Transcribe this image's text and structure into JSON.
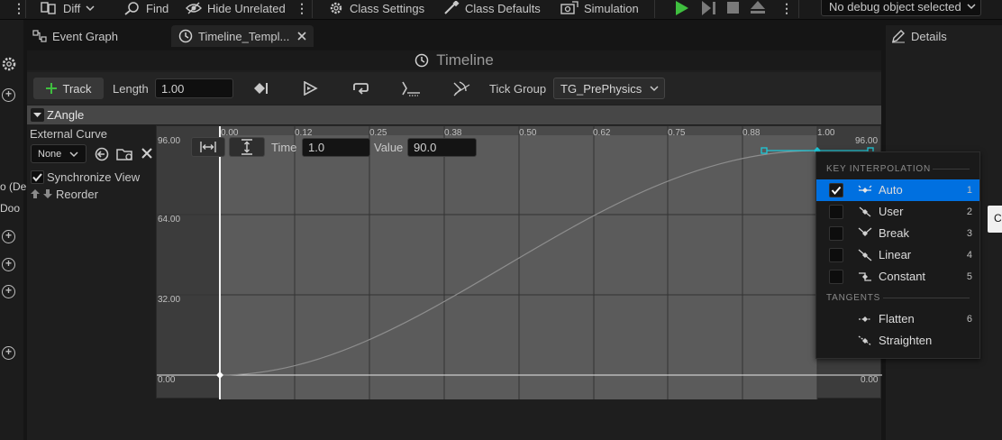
{
  "toolbar": {
    "diff_label": "Diff",
    "find_label": "Find",
    "hide_unrelated_label": "Hide Unrelated",
    "class_settings_label": "Class Settings",
    "class_defaults_label": "Class Defaults",
    "simulation_label": "Simulation",
    "debug_object_value": "No debug object selected"
  },
  "left_strip": {
    "cut_text_1": "o (De",
    "cut_text_2": "Doo"
  },
  "tabs": [
    {
      "label": "Event Graph",
      "icon": "graph-icon"
    },
    {
      "label": "Timeline_Templ...",
      "icon": "clock-icon",
      "active": true
    }
  ],
  "timeline": {
    "title": "Timeline",
    "add_track_label": "Track",
    "length_label": "Length",
    "length_value": "1.00",
    "tick_group_label": "Tick Group",
    "tick_group_value": "TG_PrePhysics"
  },
  "track": {
    "name": "ZAngle",
    "external_curve_label": "External Curve",
    "curve_select_value": "None",
    "synchronize_label": "Synchronize View",
    "synchronize_checked": true,
    "reorder_label": "Reorder"
  },
  "curve_editor": {
    "time_label": "Time",
    "time_value": "1.0",
    "value_label": "Value",
    "value_value": "90.0",
    "x_ticks": [
      "0.00",
      "0.12",
      "0.25",
      "0.38",
      "0.50",
      "0.62",
      "0.75",
      "0.88",
      "1.00"
    ],
    "y_labels": [
      "96.00",
      "64.00",
      "32.00",
      "0.00"
    ],
    "right_top_label": "96.00",
    "right_bottom_label": "0.00"
  },
  "details": {
    "title": "Details"
  },
  "menu": {
    "section_interp": "KEY INTERPOLATION",
    "section_tangents": "TANGENTS",
    "items": [
      {
        "label": "Auto",
        "key": "1",
        "checked": true,
        "selected": true
      },
      {
        "label": "User",
        "key": "2",
        "checked": false
      },
      {
        "label": "Break",
        "key": "3",
        "checked": false
      },
      {
        "label": "Linear",
        "key": "4",
        "checked": false
      },
      {
        "label": "Constant",
        "key": "5",
        "checked": false
      }
    ],
    "tangents": [
      {
        "label": "Flatten",
        "key": "6"
      },
      {
        "label": "Straighten",
        "key": ""
      }
    ]
  },
  "right_edge_cut_text": "C",
  "colors": {
    "accent_blue": "#0070e0",
    "play_green": "#3fbf3f",
    "key_cyan": "#1ec8d8",
    "curve_bg": "#5b5b5b",
    "panel_bg": "#1e1e1e"
  }
}
